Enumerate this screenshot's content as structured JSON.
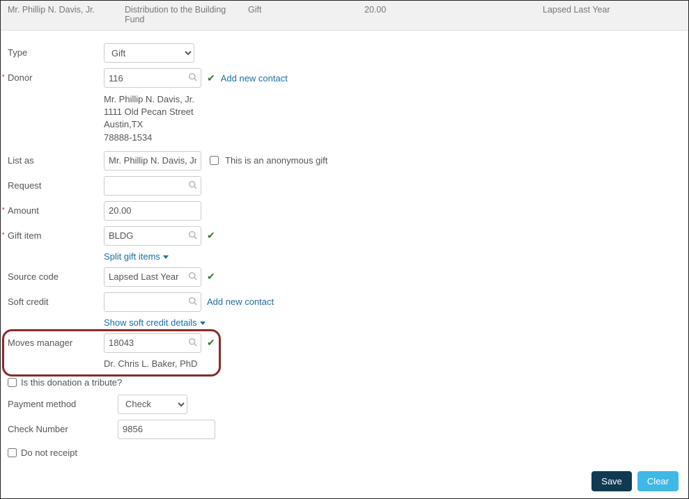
{
  "header": {
    "col1": "Mr. Phillip N. Davis, Jr.",
    "col2": "Distribution to the Building Fund",
    "col3": "Gift",
    "col4": "20.00",
    "col5": "Lapsed Last Year"
  },
  "labels": {
    "type": "Type",
    "donor": "Donor",
    "list_as": "List as",
    "request": "Request",
    "amount": "Amount",
    "gift_item": "Gift item",
    "source_code": "Source code",
    "soft_credit": "Soft credit",
    "moves_manager": "Moves manager",
    "payment_method": "Payment method",
    "check_number": "Check Number"
  },
  "values": {
    "type": "Gift",
    "donor": "116",
    "list_as": "Mr. Phillip N. Davis, Jr.",
    "request": "",
    "amount": "20.00",
    "gift_item": "BLDG",
    "source_code": "Lapsed Last Year",
    "soft_credit": "",
    "moves_manager": "18043",
    "payment_method": "Check",
    "check_number": "9856"
  },
  "donor_address": {
    "name": "Mr. Phillip N. Davis, Jr.",
    "street": "1111 Old Pecan Street",
    "city_state": "Austin,TX",
    "zip": "78888-1534"
  },
  "moves_manager_name": "Dr. Chris L. Baker, PhD",
  "links": {
    "add_new_contact": "Add new contact",
    "split_gift_items": "Split gift items",
    "show_soft_credit": "Show soft credit details"
  },
  "checkboxes": {
    "anonymous": "This is an anonymous gift",
    "tribute": "Is this donation a tribute?",
    "do_not_receipt": "Do not receipt"
  },
  "buttons": {
    "save": "Save",
    "clear": "Clear"
  },
  "colors": {
    "link": "#1a6fa3",
    "check": "#2e7d32",
    "highlight": "#8b2a2a",
    "save_btn": "#0f3a52",
    "clear_btn": "#3fb8e8"
  }
}
